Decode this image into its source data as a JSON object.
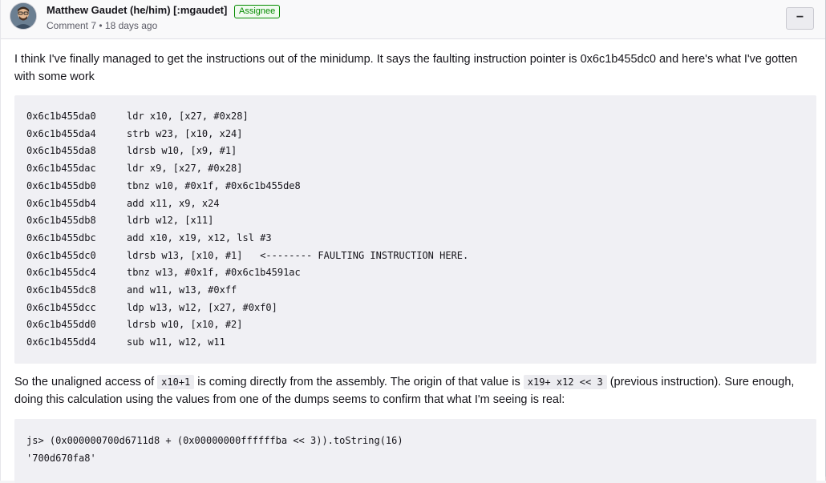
{
  "comment": {
    "author": "Matthew Gaudet (he/him) [:mgaudet]",
    "badge": "Assignee",
    "meta": "Comment 7 • 18 days ago",
    "collapse_label": "−"
  },
  "body": {
    "para1": "I think I've finally managed to get the instructions out of the minidump. It says the faulting instruction pointer is 0x6c1b455dc0 and here's what I've gotten with some work",
    "asm": [
      {
        "addr": "0x6c1b455da0",
        "instr": "ldr x10, [x27, #0x28]"
      },
      {
        "addr": "0x6c1b455da4",
        "instr": "strb w23, [x10, x24]"
      },
      {
        "addr": "0x6c1b455da8",
        "instr": "ldrsb w10, [x9, #1]"
      },
      {
        "addr": "0x6c1b455dac",
        "instr": "ldr x9, [x27, #0x28]"
      },
      {
        "addr": "0x6c1b455db0",
        "instr": "tbnz w10, #0x1f, #0x6c1b455de8"
      },
      {
        "addr": "0x6c1b455db4",
        "instr": "add x11, x9, x24"
      },
      {
        "addr": "0x6c1b455db8",
        "instr": "ldrb w12, [x11]"
      },
      {
        "addr": "0x6c1b455dbc",
        "instr": "add x10, x19, x12, lsl #3"
      },
      {
        "addr": "0x6c1b455dc0",
        "instr": "ldrsb w13, [x10, #1]   <-------- FAULTING INSTRUCTION HERE."
      },
      {
        "addr": "0x6c1b455dc4",
        "instr": "tbnz w13, #0x1f, #0x6c1b4591ac"
      },
      {
        "addr": "0x6c1b455dc8",
        "instr": "and w11, w13, #0xff"
      },
      {
        "addr": "0x6c1b455dcc",
        "instr": "ldp w13, w12, [x27, #0xf0]"
      },
      {
        "addr": "0x6c1b455dd0",
        "instr": "ldrsb w10, [x10, #2]"
      },
      {
        "addr": "0x6c1b455dd4",
        "instr": "sub w11, w12, w11"
      }
    ],
    "para2_a": "So the unaligned access of ",
    "para2_code1": "x10+1",
    "para2_b": " is coming directly from the assembly. The origin of that value is ",
    "para2_code2": "x19+ x12 << 3",
    "para2_c": " (previous instruction). Sure enough, doing this calculation using the values from one of the dumps seems to confirm that what I'm seeing is real:",
    "js_line1": "js> (0x000000700d6711d8 + (0x00000000ffffffba << 3)).toString(16)",
    "js_line2": "'700d670fa8'"
  }
}
